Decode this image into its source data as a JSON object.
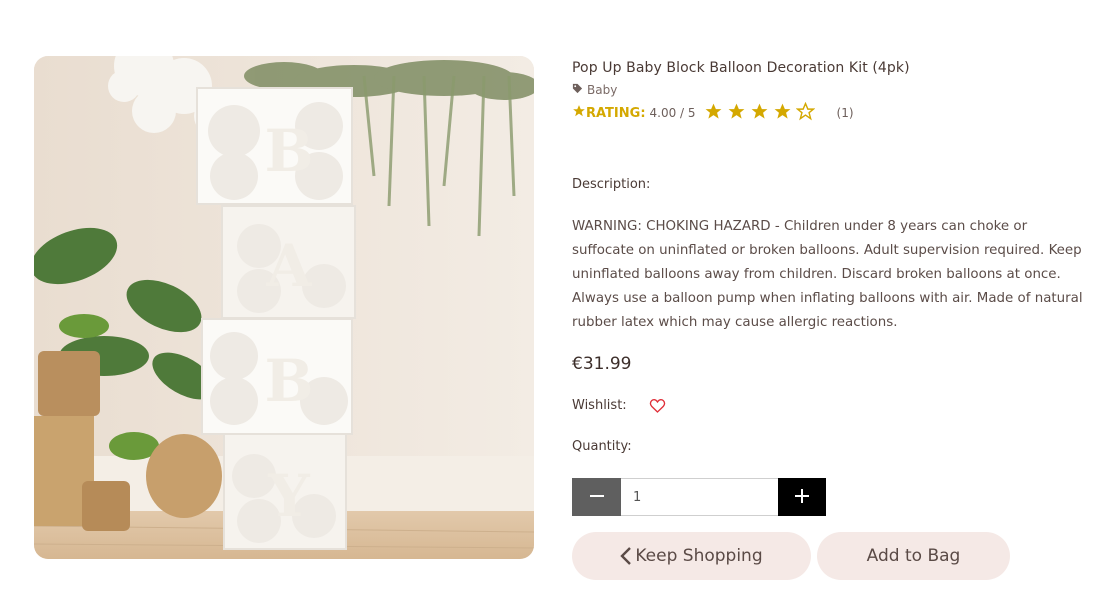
{
  "product": {
    "title": "Pop Up Baby Block Balloon Decoration Kit (4pk)",
    "category": "Baby",
    "rating": {
      "label": "RATING:",
      "score": "4.00 / 5",
      "value": 4,
      "max": 5,
      "count": "(1)"
    },
    "description_label": "Description:",
    "description": "WARNING: CHOKING HAZARD - Children under 8 years can choke or suffocate on uninflated or broken balloons. Adult supervision required. Keep uninflated balloons away from children. Discard broken balloons at once. Always use a balloon pump when inflating balloons with air. Made of natural rubber latex which may cause allergic reactions.",
    "price": "€31.99",
    "wishlist_label": "Wishlist:",
    "quantity_label": "Quantity:",
    "quantity_value": "1",
    "image_letters": [
      "B",
      "A",
      "B",
      "Y"
    ]
  },
  "buttons": {
    "keep_shopping": "Keep Shopping",
    "add_to_bag": "Add to Bag"
  },
  "colors": {
    "star": "#d4a800",
    "button_bg": "#f5e9e6",
    "heart": "#e0303a",
    "minus_bg": "#5f5f5f",
    "plus_bg": "#000000"
  },
  "icons": {
    "category": "tag-icon",
    "rating": "star-icon",
    "wishlist": "heart-icon",
    "keep_shopping": "chevron-left-icon"
  }
}
